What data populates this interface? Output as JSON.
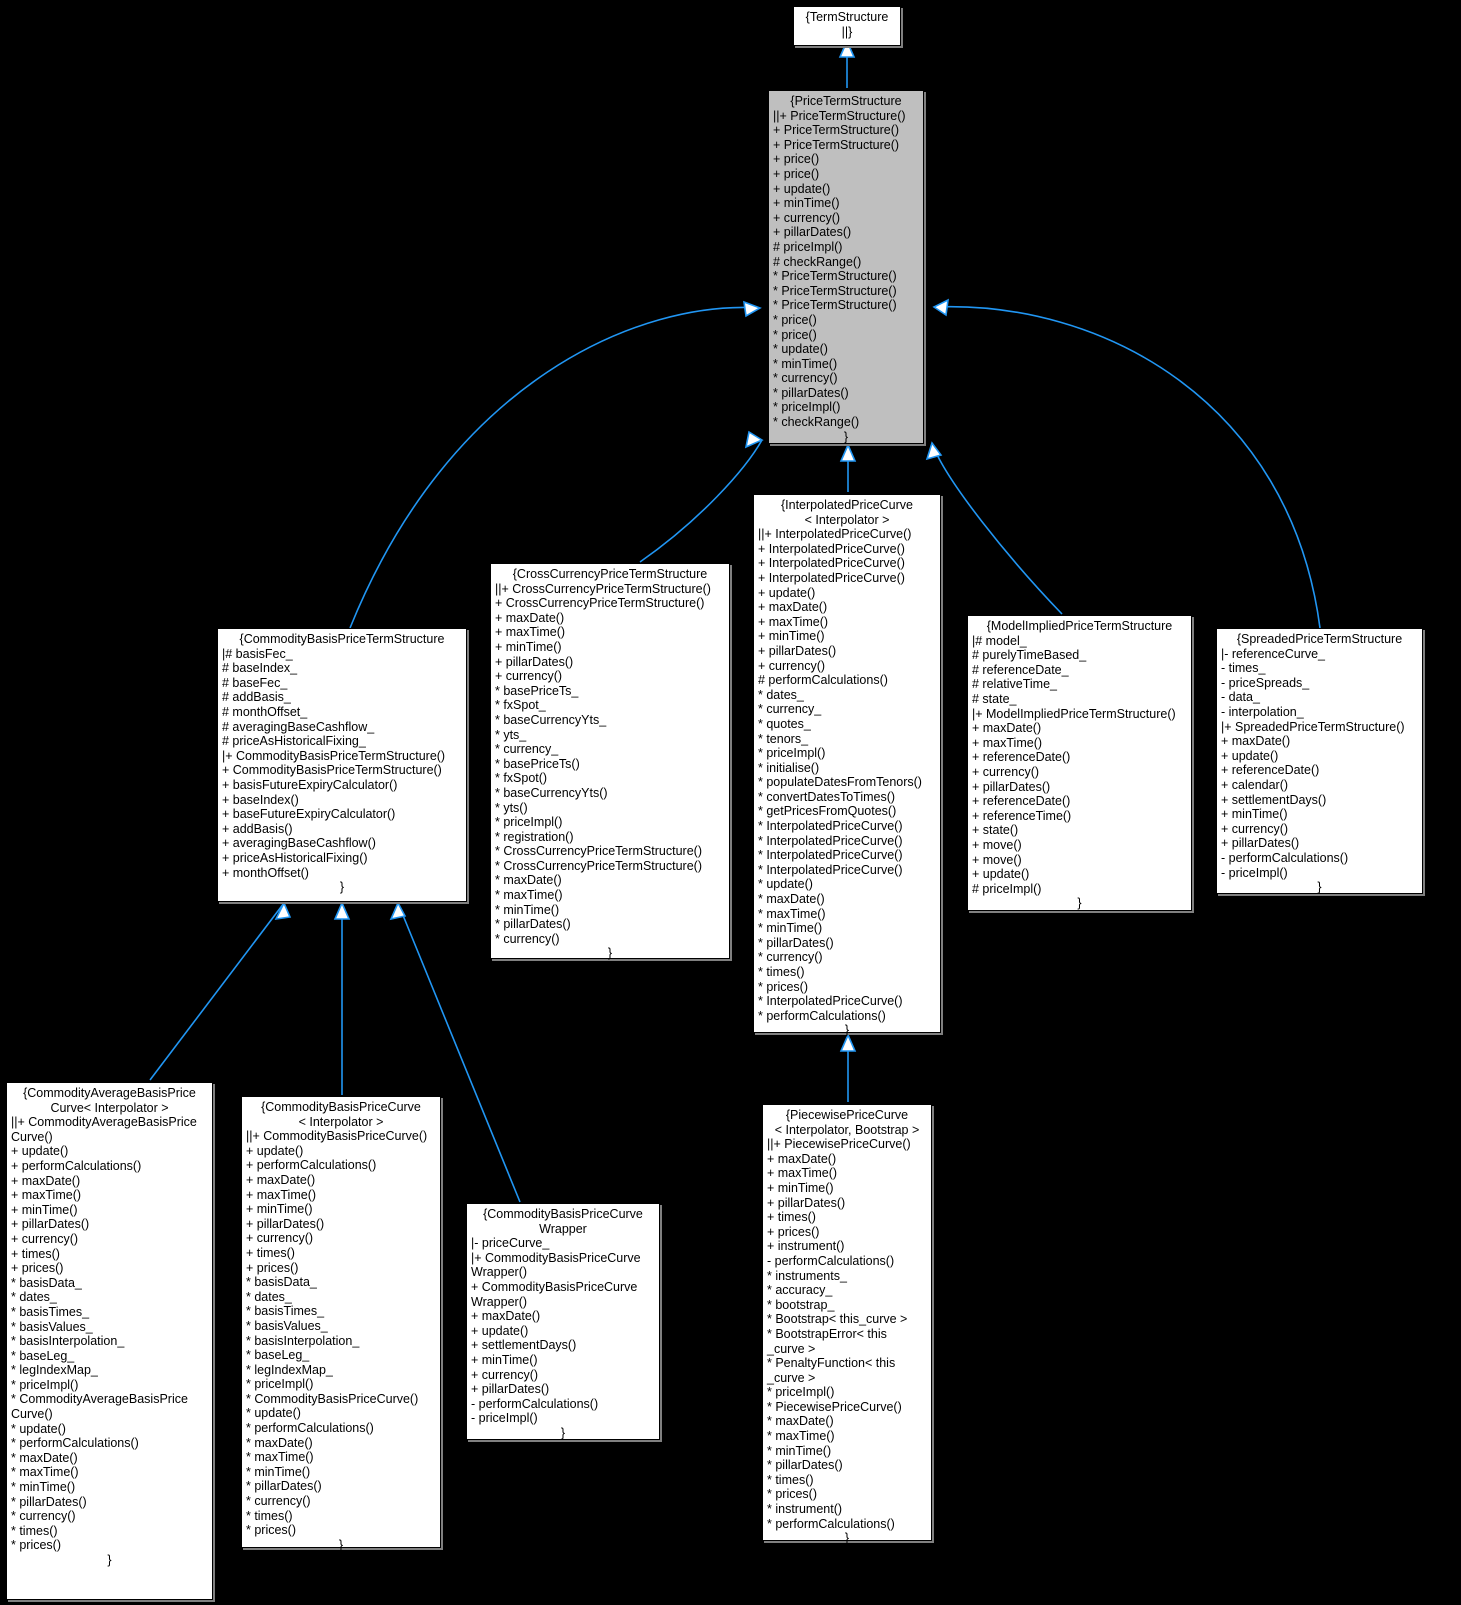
{
  "diagram": {
    "kind": "uml-class-inheritance-graph",
    "background": "#000000",
    "edge_color": "#2196f3",
    "root_fill": "#bfbfbf",
    "node_fill": "#ffffff"
  },
  "nodes": {
    "term_structure": {
      "title": "{TermStructure\n||}",
      "members": []
    },
    "price_term_structure": {
      "title": "{PriceTermStructure",
      "members": [
        "||+ PriceTermStructure()",
        "+ PriceTermStructure()",
        "+ PriceTermStructure()",
        "+ price()",
        "+ price()",
        "+ update()",
        "+ minTime()",
        "+ currency()",
        "+ pillarDates()",
        "# priceImpl()",
        "# checkRange()",
        "* PriceTermStructure()",
        "* PriceTermStructure()",
        "* PriceTermStructure()",
        "* price()",
        "* price()",
        "* update()",
        "* minTime()",
        "* currency()",
        "* pillarDates()",
        "* priceImpl()",
        "* checkRange()"
      ],
      "closer": "}"
    },
    "commodity_basis_price_term_structure": {
      "title": "{CommodityBasisPriceTermStructure",
      "members": [
        "|# basisFec_",
        "# baseIndex_",
        "# baseFec_",
        "# addBasis_",
        "# monthOffset_",
        "# averagingBaseCashflow_",
        "# priceAsHistoricalFixing_",
        "|+ CommodityBasisPriceTermStructure()",
        "+ CommodityBasisPriceTermStructure()",
        "+ basisFutureExpiryCalculator()",
        "+ baseIndex()",
        "+ baseFutureExpiryCalculator()",
        "+ addBasis()",
        "+ averagingBaseCashflow()",
        "+ priceAsHistoricalFixing()",
        "+ monthOffset()"
      ],
      "closer": "}"
    },
    "cross_currency_price_term_structure": {
      "title": "{CrossCurrencyPriceTermStructure",
      "members": [
        "||+ CrossCurrencyPriceTermStructure()",
        "+ CrossCurrencyPriceTermStructure()",
        "+ maxDate()",
        "+ maxTime()",
        "+ minTime()",
        "+ pillarDates()",
        "+ currency()",
        "* basePriceTs_",
        "* fxSpot_",
        "* baseCurrencyYts_",
        "* yts_",
        "* currency_",
        "* basePriceTs()",
        "* fxSpot()",
        "* baseCurrencyYts()",
        "* yts()",
        "* priceImpl()",
        "* registration()",
        "* CrossCurrencyPriceTermStructure()",
        "* CrossCurrencyPriceTermStructure()",
        "* maxDate()",
        "* maxTime()",
        "* minTime()",
        "* pillarDates()",
        "* currency()"
      ],
      "closer": "}"
    },
    "interpolated_price_curve": {
      "title": "{InterpolatedPriceCurve\n< Interpolator >",
      "members": [
        "||+ InterpolatedPriceCurve()",
        "+ InterpolatedPriceCurve()",
        "+ InterpolatedPriceCurve()",
        "+ InterpolatedPriceCurve()",
        "+ update()",
        "+ maxDate()",
        "+ maxTime()",
        "+ minTime()",
        "+ pillarDates()",
        "+ currency()",
        "# performCalculations()",
        "* dates_",
        "* currency_",
        "* quotes_",
        "* tenors_",
        "* priceImpl()",
        "* initialise()",
        "* populateDatesFromTenors()",
        "* convertDatesToTimes()",
        "* getPricesFromQuotes()",
        "* InterpolatedPriceCurve()",
        "* InterpolatedPriceCurve()",
        "* InterpolatedPriceCurve()",
        "* InterpolatedPriceCurve()",
        "* update()",
        "* maxDate()",
        "* maxTime()",
        "* minTime()",
        "* pillarDates()",
        "* currency()",
        "* times()",
        "* prices()",
        "* InterpolatedPriceCurve()",
        "* performCalculations()"
      ],
      "closer": "}"
    },
    "model_implied_price_term_structure": {
      "title": "{ModelImpliedPriceTermStructure",
      "members": [
        "|# model_",
        "# purelyTimeBased_",
        "# referenceDate_",
        "# relativeTime_",
        "# state_",
        "|+ ModelImpliedPriceTermStructure()",
        "+ maxDate()",
        "+ maxTime()",
        "+ referenceDate()",
        "+ currency()",
        "+ pillarDates()",
        "+ referenceDate()",
        "+ referenceTime()",
        "+ state()",
        "+ move()",
        "+ move()",
        "+ update()",
        "# priceImpl()"
      ],
      "closer": "}"
    },
    "spreaded_price_term_structure": {
      "title": "{SpreadedPriceTermStructure",
      "members": [
        "|- referenceCurve_",
        "- times_",
        "- priceSpreads_",
        "- data_",
        "- interpolation_",
        "|+ SpreadedPriceTermStructure()",
        "+ maxDate()",
        "+ update()",
        "+ referenceDate()",
        "+ calendar()",
        "+ settlementDays()",
        "+ minTime()",
        "+ currency()",
        "+ pillarDates()",
        "- performCalculations()",
        "- priceImpl()"
      ],
      "closer": "}"
    },
    "commodity_average_basis_price_curve": {
      "title": "{CommodityAverageBasisPrice\nCurve< Interpolator >",
      "members": [
        "||+ CommodityAverageBasisPrice\nCurve()",
        "+ update()",
        "+ performCalculations()",
        "+ maxDate()",
        "+ maxTime()",
        "+ minTime()",
        "+ pillarDates()",
        "+ currency()",
        "+ times()",
        "+ prices()",
        "* basisData_",
        "* dates_",
        "* basisTimes_",
        "* basisValues_",
        "* basisInterpolation_",
        "* baseLeg_",
        "* legIndexMap_",
        "* priceImpl()",
        "* CommodityAverageBasisPrice\nCurve()",
        "* update()",
        "* performCalculations()",
        "* maxDate()",
        "* maxTime()",
        "* minTime()",
        "* pillarDates()",
        "* currency()",
        "* times()",
        "* prices()"
      ],
      "closer": "}"
    },
    "commodity_basis_price_curve": {
      "title": "{CommodityBasisPriceCurve\n< Interpolator >",
      "members": [
        "||+ CommodityBasisPriceCurve()",
        "+ update()",
        "+ performCalculations()",
        "+ maxDate()",
        "+ maxTime()",
        "+ minTime()",
        "+ pillarDates()",
        "+ currency()",
        "+ times()",
        "+ prices()",
        "* basisData_",
        "* dates_",
        "* basisTimes_",
        "* basisValues_",
        "* basisInterpolation_",
        "* baseLeg_",
        "* legIndexMap_",
        "* priceImpl()",
        "* CommodityBasisPriceCurve()",
        "* update()",
        "* performCalculations()",
        "* maxDate()",
        "* maxTime()",
        "* minTime()",
        "* pillarDates()",
        "* currency()",
        "* times()",
        "* prices()"
      ],
      "closer": "}"
    },
    "commodity_basis_price_curve_wrapper": {
      "title": "{CommodityBasisPriceCurve\nWrapper",
      "members": [
        "|- priceCurve_",
        "|+ CommodityBasisPriceCurve\nWrapper()",
        "+ CommodityBasisPriceCurve\nWrapper()",
        "+ maxDate()",
        "+ update()",
        "+ settlementDays()",
        "+ minTime()",
        "+ currency()",
        "+ pillarDates()",
        "- performCalculations()",
        "- priceImpl()"
      ],
      "closer": "}"
    },
    "piecewise_price_curve": {
      "title": "{PiecewisePriceCurve\n< Interpolator, Bootstrap >",
      "members": [
        "||+ PiecewisePriceCurve()",
        "+ maxDate()",
        "+ maxTime()",
        "+ minTime()",
        "+ pillarDates()",
        "+ times()",
        "+ prices()",
        "+ instrument()",
        "- performCalculations()",
        "* instruments_",
        "* accuracy_",
        "* bootstrap_",
        "* Bootstrap< this_curve >",
        "* BootstrapError< this\n_curve >",
        "* PenaltyFunction< this\n_curve >",
        "* priceImpl()",
        "* PiecewisePriceCurve()",
        "* maxDate()",
        "* maxTime()",
        "* minTime()",
        "* pillarDates()",
        "* times()",
        "* prices()",
        "* instrument()",
        "* performCalculations()"
      ],
      "closer": "}"
    }
  }
}
